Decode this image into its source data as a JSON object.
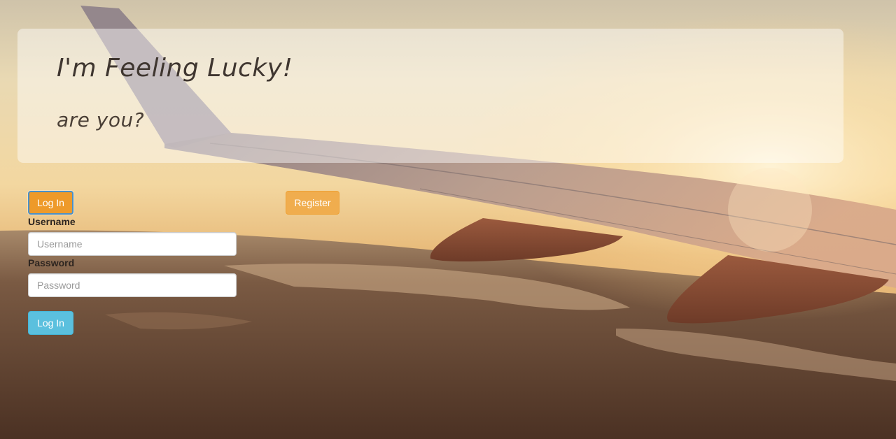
{
  "jumbotron": {
    "title": "I'm Feeling Lucky!",
    "subtitle": "are you?"
  },
  "tabs": {
    "login_label": "Log In",
    "register_label": "Register"
  },
  "login_form": {
    "username_label": "Username",
    "username_placeholder": "Username",
    "password_label": "Password",
    "password_placeholder": "Password",
    "submit_label": "Log In"
  },
  "background": {
    "image_icon": "airplane-wing-sunset-image"
  },
  "colors": {
    "tab_login": "#ee9a2a",
    "tab_register": "#f0ad4e",
    "submit": "#5bc0de",
    "tab_focus_border": "#4a90c8"
  }
}
